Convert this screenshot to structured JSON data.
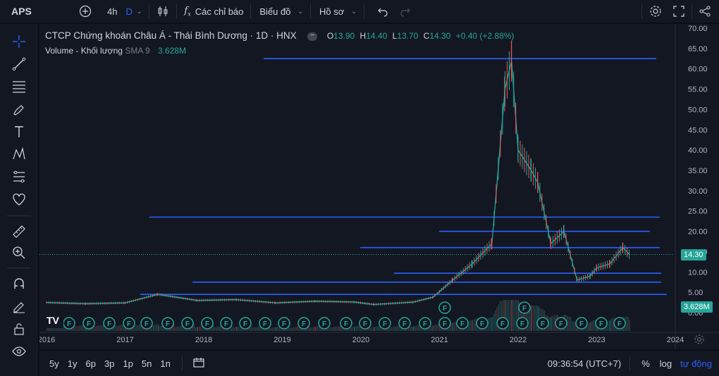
{
  "toolbar": {
    "symbol": "APS",
    "interval": "4h",
    "interval_tag": "D",
    "indicators_label": "Các chỉ báo",
    "chart_label": "Biểu đồ",
    "profile_label": "Hồ sơ"
  },
  "legend": {
    "title": "CTCP Chứng khoán Châu Á - Thái Bình Dương · 1D · HNX",
    "o_label": "O",
    "o_value": "13.90",
    "h_label": "H",
    "h_value": "14.40",
    "l_label": "L",
    "l_value": "13.70",
    "c_label": "C",
    "c_value": "14.30",
    "change": "+0.40 (+2.88%)",
    "volume_label": "Volume - Khối lượng",
    "volume_sma": "SMA 9",
    "volume_value": "3.628M"
  },
  "price_axis": {
    "ticks": [
      "70.00",
      "65.00",
      "60.00",
      "55.00",
      "50.00",
      "45.00",
      "40.00",
      "35.00",
      "30.00",
      "25.00",
      "20.00",
      "15.00",
      "10.00",
      "5.00",
      "0.00"
    ],
    "current_price_label": "14.30",
    "volume_label": "3.628M"
  },
  "time_axis": {
    "labels": [
      "2016",
      "2017",
      "2018",
      "2019",
      "2020",
      "2021",
      "2022",
      "2023",
      "2024"
    ]
  },
  "bottom": {
    "ranges": [
      "5y",
      "1y",
      "6p",
      "3p",
      "1p",
      "5n",
      "1n"
    ],
    "clock": "09:36:54 (UTC+7)",
    "percent": "%",
    "log": "log",
    "auto": "tự động"
  },
  "colors": {
    "up": "#26a69a",
    "down": "#ef5350",
    "hline": "#2962ff",
    "accent": "#2962ff",
    "background": "#131722"
  },
  "chart_data": {
    "type": "line",
    "x": [
      "2016-01",
      "2016-07",
      "2017-01",
      "2017-06",
      "2017-12",
      "2018-06",
      "2018-12",
      "2019-06",
      "2019-12",
      "2020-03",
      "2020-09",
      "2020-12",
      "2021-03",
      "2021-06",
      "2021-09",
      "2021-11",
      "2021-12",
      "2022-01",
      "2022-03",
      "2022-04",
      "2022-06",
      "2022-08",
      "2022-10",
      "2022-12",
      "2023-01",
      "2023-03",
      "2023-05",
      "2023-06"
    ],
    "series": [
      {
        "values": [
          2.5,
          2.2,
          2.4,
          4.5,
          3.0,
          3.2,
          2.4,
          2.8,
          2.6,
          2.0,
          2.6,
          3.8,
          8,
          12,
          17,
          55,
          62,
          40,
          35,
          32,
          17,
          20,
          8,
          9,
          11,
          12,
          16,
          14.3
        ]
      }
    ],
    "ylim": [
      0,
      70
    ],
    "horizontal_levels": [
      62.5,
      23.5,
      20.0,
      16.0,
      9.7,
      7.5,
      4.5
    ],
    "marker_label": "F"
  }
}
